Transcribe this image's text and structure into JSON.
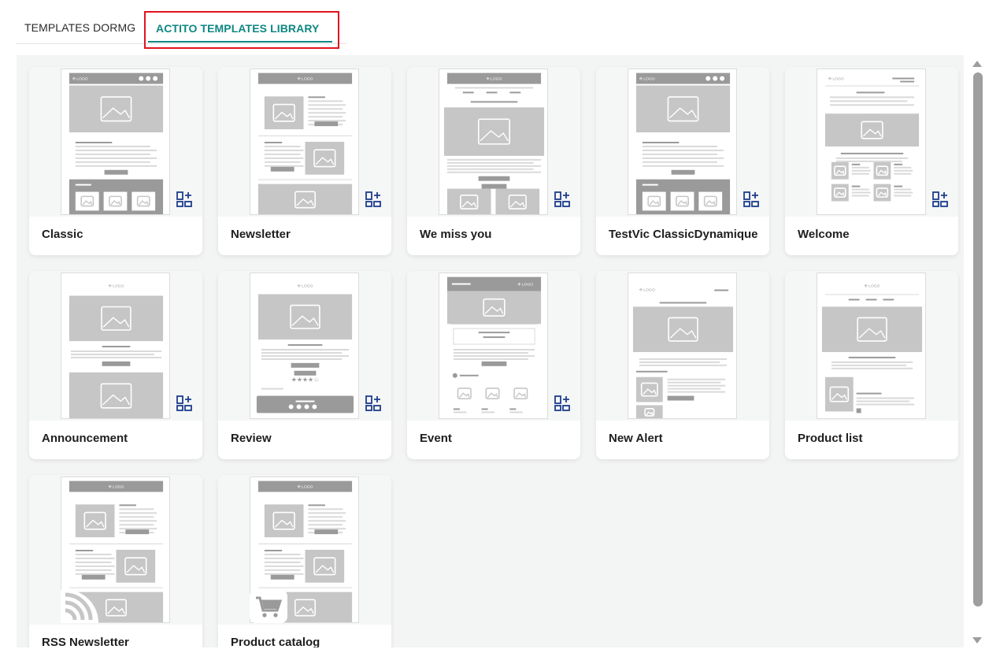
{
  "tabs": [
    {
      "label": "TEMPLATES DORMG",
      "active": false
    },
    {
      "label": "ACTITO TEMPLATES LIBRARY",
      "active": true
    }
  ],
  "colors": {
    "accent": "#0f8783",
    "highlight": "#e0141e",
    "add_icon": "#1d3d8c",
    "thumb_gray": "#c6c6c6"
  },
  "templates": [
    {
      "name": "Classic",
      "layout": "classic",
      "badge": "add-template-icon"
    },
    {
      "name": "Newsletter",
      "layout": "newsletter",
      "badge": "add-template-icon"
    },
    {
      "name": "We miss you",
      "layout": "wemiss",
      "badge": "add-template-icon"
    },
    {
      "name": "TestVic ClassicDynamique",
      "layout": "classic",
      "badge": "add-template-icon"
    },
    {
      "name": "Welcome",
      "layout": "welcome",
      "badge": "add-template-icon"
    },
    {
      "name": "Announcement",
      "layout": "announce",
      "badge": "add-template-icon"
    },
    {
      "name": "Review",
      "layout": "review",
      "badge": "add-template-icon"
    },
    {
      "name": "Event",
      "layout": "event",
      "badge": "add-template-icon"
    },
    {
      "name": "New Alert",
      "layout": "alert",
      "badge": null
    },
    {
      "name": "Product list",
      "layout": "plist",
      "badge": null
    },
    {
      "name": "RSS Newsletter",
      "layout": "newsletter",
      "badge": "rss-icon"
    },
    {
      "name": "Product catalog",
      "layout": "newsletter",
      "badge": "cart-icon"
    }
  ],
  "thumb_logo_text": "LOGO"
}
